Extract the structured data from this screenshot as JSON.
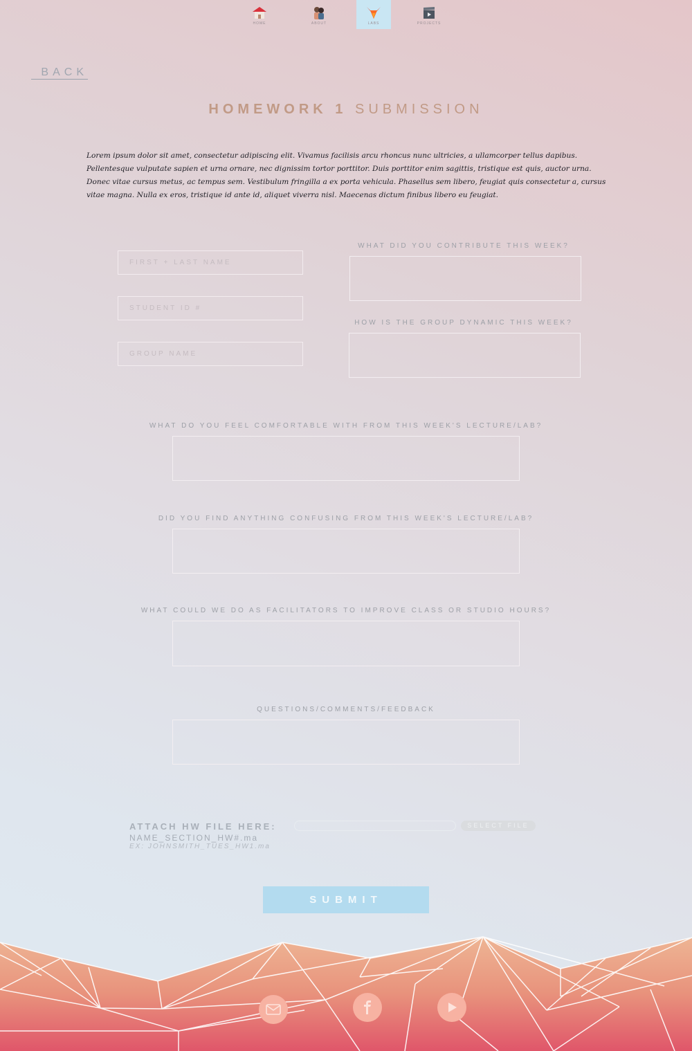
{
  "nav": {
    "items": [
      {
        "label": "home",
        "icon": "house-icon"
      },
      {
        "label": "about",
        "icon": "people-icon"
      },
      {
        "label": "labs",
        "icon": "fox-icon"
      },
      {
        "label": "projects",
        "icon": "clapperboard-icon"
      }
    ],
    "active": "labs"
  },
  "back_label": "BACK",
  "title": {
    "bold": "HOMEWORK 1",
    "light": "SUBMISSION"
  },
  "intro": "Lorem ipsum dolor sit amet, consectetur adipiscing elit. Vivamus facilisis arcu rhoncus nunc ultricies, a ullamcorper tellus dapibus. Pellentesque vulputate sapien et urna ornare, nec dignissim tortor porttitor. Duis porttitor enim sagittis, tristique est quis, auctor urna. Donec vitae cursus metus, ac tempus sem. Vestibulum fringilla a ex porta vehicula. Phasellus sem libero, feugiat quis consectetur a, cursus vitae magna. Nulla ex eros, tristique id ante id, aliquet viverra nisl. Maecenas dictum finibus libero eu feugiat.",
  "form": {
    "name_placeholder": "FIRST + LAST NAME",
    "student_id_placeholder": "STUDENT ID #",
    "group_placeholder": "GROUP NAME",
    "q_contribute": "WHAT DID YOU CONTRIBUTE THIS WEEK?",
    "q_dynamic": "HOW IS THE GROUP DYNAMIC THIS WEEK?",
    "q_comfortable": "WHAT DO YOU FEEL COMFORTABLE WITH FROM THIS WEEK'S LECTURE/LAB?",
    "q_confusing": "DID YOU FIND ANYTHING CONFUSING FROM THIS WEEK'S LECTURE/LAB?",
    "q_improve": "WHAT COULD WE DO AS FACILITATORS TO IMPROVE CLASS OR STUDIO HOURS?",
    "q_feedback": "QUESTIONS/COMMENTS/FEEDBACK"
  },
  "attach": {
    "label": "ATTACH HW FILE HERE:",
    "hint": "NAME_SECTION_HW#.ma",
    "example": "EX: JOHNSMITH_TUES_HW1.ma",
    "select_label": "SELECT FILE"
  },
  "submit_label": "SUBMIT",
  "footer": {
    "social": [
      "email-icon",
      "facebook-icon",
      "youtube-icon"
    ]
  },
  "colors": {
    "accent_title": "#c19a86",
    "submit_bg": "#b3dbef",
    "nav_active_bg": "#c9e6f3",
    "footer_top": "#eeb594",
    "footer_bottom": "#e0566a"
  }
}
